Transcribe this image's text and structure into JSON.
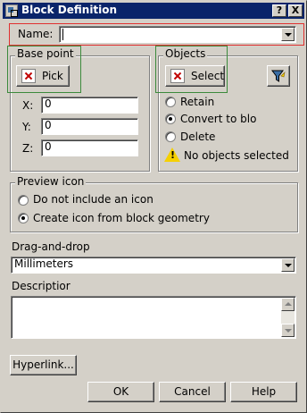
{
  "window": {
    "title": "Block Definition",
    "help_glyph": "?",
    "close_glyph": "X"
  },
  "name": {
    "label": "Name:",
    "value": ""
  },
  "base_point": {
    "title": "Base point",
    "pick_label": "Pick",
    "x_label": "X:",
    "x_value": "0",
    "y_label": "Y:",
    "y_value": "0",
    "z_label": "Z:",
    "z_value": "0"
  },
  "objects": {
    "title": "Objects",
    "select_label": "Select",
    "filter_icon": "quick-select-filter-icon",
    "options": [
      {
        "label": "Retain",
        "selected": false
      },
      {
        "label": "Convert to blo",
        "selected": true
      },
      {
        "label": "Delete",
        "selected": false
      }
    ],
    "warning_text": "No objects selected"
  },
  "preview_icon": {
    "title": "Preview icon",
    "options": [
      {
        "label": "Do not include an icon",
        "selected": false
      },
      {
        "label": "Create icon from block geometry",
        "selected": true
      }
    ]
  },
  "drag_and_drop": {
    "label": "Drag-and-drop",
    "value": "Millimeters"
  },
  "description": {
    "label": "Descriptior",
    "value": ""
  },
  "buttons": {
    "hyperlink": "Hyperlink...",
    "ok": "OK",
    "cancel": "Cancel",
    "help": "Help"
  },
  "colors": {
    "title_bar": "#0a246a",
    "dialog_face": "#d4d0c8",
    "highlight_green": "#3c8a3c",
    "highlight_red": "#e03030",
    "warning_yellow": "#f5d000"
  }
}
